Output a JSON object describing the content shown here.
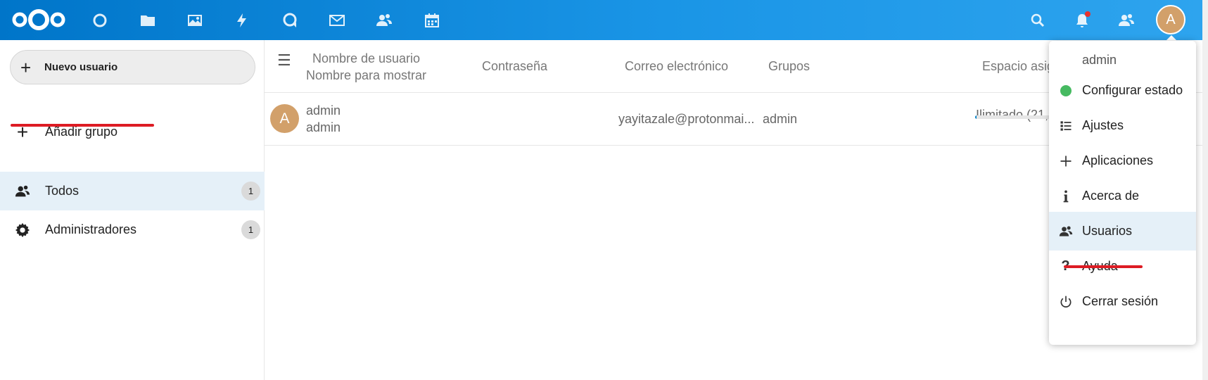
{
  "header": {
    "apps": [
      {
        "icon": "dashboard-icon"
      },
      {
        "icon": "files-icon"
      },
      {
        "icon": "photos-icon"
      },
      {
        "icon": "activity-icon"
      },
      {
        "icon": "talk-icon"
      },
      {
        "icon": "mail-icon"
      },
      {
        "icon": "contacts-icon"
      },
      {
        "icon": "calendar-icon"
      }
    ],
    "avatar_initial": "A",
    "notification_dot_color": "#e9322d"
  },
  "nav": {
    "new_user_label": "Nuevo usuario",
    "add_group_label": "Añadir grupo",
    "groups": [
      {
        "label": "Todos",
        "count": "1"
      },
      {
        "label": "Administradores",
        "count": "1"
      }
    ]
  },
  "table": {
    "headers": {
      "username": "Nombre de usuario",
      "display_name": "Nombre para mostrar",
      "password": "Contraseña",
      "email": "Correo electrónico",
      "groups": "Grupos",
      "quota": "Espacio asig"
    },
    "rows": [
      {
        "avatar_initial": "A",
        "username": "admin",
        "display_name": "admin",
        "email": "yayitazale@protonmai...",
        "groups": "admin",
        "quota": "Ilimitado (21,"
      }
    ]
  },
  "user_menu": {
    "name": "admin",
    "items": [
      {
        "label": "Configurar estado",
        "icon": "status-dot-icon"
      },
      {
        "label": "Ajustes",
        "icon": "settings-list-icon"
      },
      {
        "label": "Aplicaciones",
        "icon": "plus-icon"
      },
      {
        "label": "Acerca de",
        "icon": "info-icon"
      },
      {
        "label": "Usuarios",
        "icon": "users-icon"
      },
      {
        "label": "Ayuda",
        "icon": "help-icon"
      },
      {
        "label": "Cerrar sesión",
        "icon": "power-icon"
      }
    ]
  },
  "colors": {
    "header_start": "#0075c9",
    "header_end": "#2ea4ee",
    "status_online": "#46ba61",
    "avatar": "#d2a06a",
    "annotation_underline": "#dd1c24",
    "selected_row": "#e5f0f8"
  }
}
